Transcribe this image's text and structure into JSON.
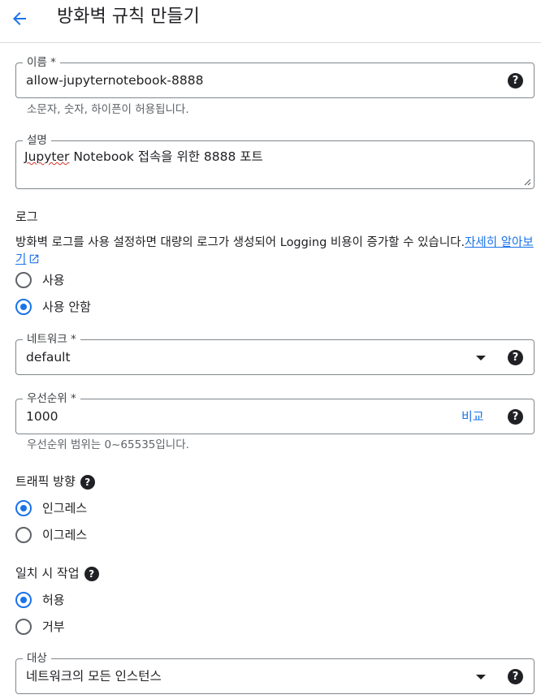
{
  "header": {
    "title": "방화벽 규칙 만들기",
    "back_icon": "arrow-back-icon"
  },
  "name_field": {
    "label": "이름 *",
    "value": "allow-jupyternotebook-8888",
    "hint": "소문자, 숫자, 하이픈이 허용됩니다."
  },
  "description_field": {
    "label": "설명",
    "value_first_word": "Jupyter",
    "value_rest": " Notebook 접속을 위한 8888 포트"
  },
  "logs": {
    "title": "로그",
    "description": "방화벽 로그를 사용 설정하면 대량의 로그가 생성되어 Logging 비용이 증가할 수 있습니다.",
    "learn_more": "자세히 알아보기",
    "options": [
      {
        "label": "사용",
        "checked": false
      },
      {
        "label": "사용 안함",
        "checked": true
      }
    ]
  },
  "network_field": {
    "label": "네트워크 *",
    "value": "default"
  },
  "priority_field": {
    "label": "우선순위 *",
    "value": "1000",
    "compare": "비교",
    "hint": "우선순위 범위는 0~65535입니다."
  },
  "traffic_direction": {
    "title": "트래픽 방향",
    "options": [
      {
        "label": "인그레스",
        "checked": true
      },
      {
        "label": "이그레스",
        "checked": false
      }
    ]
  },
  "action_on_match": {
    "title": "일치 시 작업",
    "options": [
      {
        "label": "허용",
        "checked": true
      },
      {
        "label": "거부",
        "checked": false
      }
    ]
  },
  "target_field": {
    "label": "대상",
    "value": "네트워크의 모든 인스턴스"
  },
  "help_glyph": "?",
  "colors": {
    "accent": "#1a73e8",
    "text": "#202124",
    "secondary_text": "#5f6368",
    "border": "#80868b",
    "spellcheck": "#d93025"
  }
}
